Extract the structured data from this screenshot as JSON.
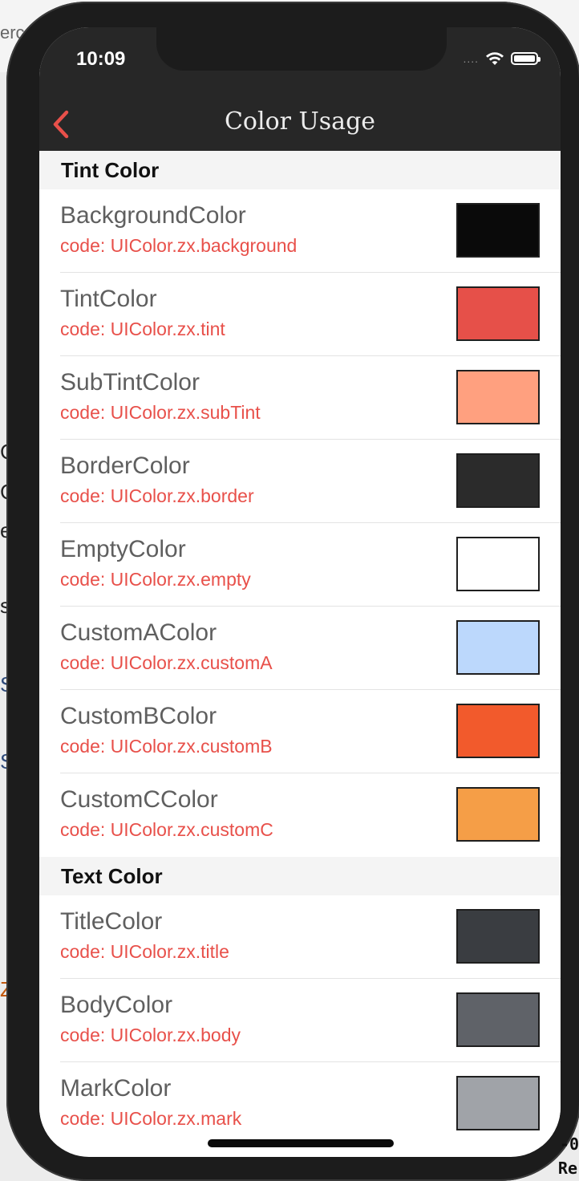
{
  "status_bar": {
    "time": "10:09",
    "signal": "....",
    "icons": [
      "wifi-icon",
      "battery-icon"
    ]
  },
  "nav": {
    "title": "Color Usage",
    "back_icon": "chevron-left-icon",
    "accent": "#e8504a"
  },
  "sections": [
    {
      "header": "Tint Color",
      "rows": [
        {
          "title": "BackgroundColor",
          "code": "code: UIColor.zx.background",
          "color": "#0a0a0a"
        },
        {
          "title": "TintColor",
          "code": "code: UIColor.zx.tint",
          "color": "#e65049"
        },
        {
          "title": "SubTintColor",
          "code": "code: UIColor.zx.subTint",
          "color": "#ffa07f"
        },
        {
          "title": "BorderColor",
          "code": "code: UIColor.zx.border",
          "color": "#2b2b2b"
        },
        {
          "title": "EmptyColor",
          "code": "code: UIColor.zx.empty",
          "color": "#ffffff"
        },
        {
          "title": "CustomAColor",
          "code": "code: UIColor.zx.customA",
          "color": "#bcd8fc"
        },
        {
          "title": "CustomBColor",
          "code": "code: UIColor.zx.customB",
          "color": "#f25a2c"
        },
        {
          "title": "CustomCColor",
          "code": "code: UIColor.zx.customC",
          "color": "#f59e47"
        }
      ]
    },
    {
      "header": "Text Color",
      "rows": [
        {
          "title": "TitleColor",
          "code": "code: UIColor.zx.title",
          "color": "#3a3d41"
        },
        {
          "title": "BodyColor",
          "code": "code: UIColor.zx.body",
          "color": "#5f6268"
        },
        {
          "title": "MarkColor",
          "code": "code: UIColor.zx.mark",
          "color": "#a0a3a8"
        }
      ]
    }
  ],
  "background_fragments": {
    "top_left": "erc",
    "letters": [
      "C",
      "C",
      "e",
      "s",
      "S",
      "S",
      "Z"
    ],
    "bottom_right": [
      "-0",
      "Re"
    ]
  }
}
